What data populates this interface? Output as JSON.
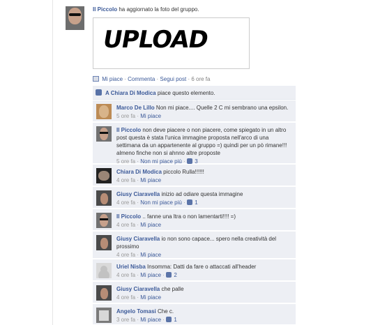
{
  "story": {
    "author": "Il Piccolo",
    "action_text": "ha aggiornato la foto del gruppo.",
    "photo_text": "UPLOAD",
    "actions": {
      "like": "Mi piace",
      "comment": "Commenta",
      "follow": "Segui post",
      "time": "6 ore fa"
    },
    "likes": {
      "liker": "A Chiara Di Modica",
      "text": "piace questo elemento."
    }
  },
  "comments": [
    {
      "author": "Marco De Lillo",
      "text": "Non mi piace.... Quelle 2 C mi sembrano una epsilon.",
      "time": "5 ore fa",
      "action": "Mi piace",
      "count": ""
    },
    {
      "author": "Il Piccolo",
      "text": "non deve piacere o non piacere, come spiegato in un altro post questa è stata l'unica immagine proposta nell'arco di una settimana da un appartenente al gruppo =) quindi per un pò rimane!!! almeno finche non si ahnno altre proposte",
      "time": "5 ore fa",
      "action": "Non mi piace più",
      "count": "3"
    },
    {
      "author": "Chiara Di Modica",
      "text": "piccolo Rulla!!!!!!",
      "time": "4 ore fa",
      "action": "Mi piace",
      "count": ""
    },
    {
      "author": "Giusy Ciaravella",
      "text": "inizio ad odiare questa immagine",
      "time": "4 ore fa",
      "action": "Non mi piace più",
      "count": "1"
    },
    {
      "author": "Il Piccolo",
      "text": ".. fanne una ltra o non lamentarti!!!! =)",
      "time": "4 ore fa",
      "action": "Mi piace",
      "count": ""
    },
    {
      "author": "Giusy Ciaravella",
      "text": "io non sono capace... spero nella creatività del prossimo",
      "time": "4 ore fa",
      "action": "Mi piace",
      "count": ""
    },
    {
      "author": "Uriel Nisba",
      "text": "Insomma: Datti da fare o attaccati all'header",
      "time": "4 ore fa",
      "action": "Mi piace",
      "count": "2"
    },
    {
      "author": "Giusy Ciaravella",
      "text": "che palle",
      "time": "4 ore fa",
      "action": "Mi piace",
      "count": ""
    },
    {
      "author": "Angelo Tomasi",
      "text": "Che c.",
      "time": "3 ore fa",
      "action": "Mi piace",
      "count": "1"
    }
  ]
}
